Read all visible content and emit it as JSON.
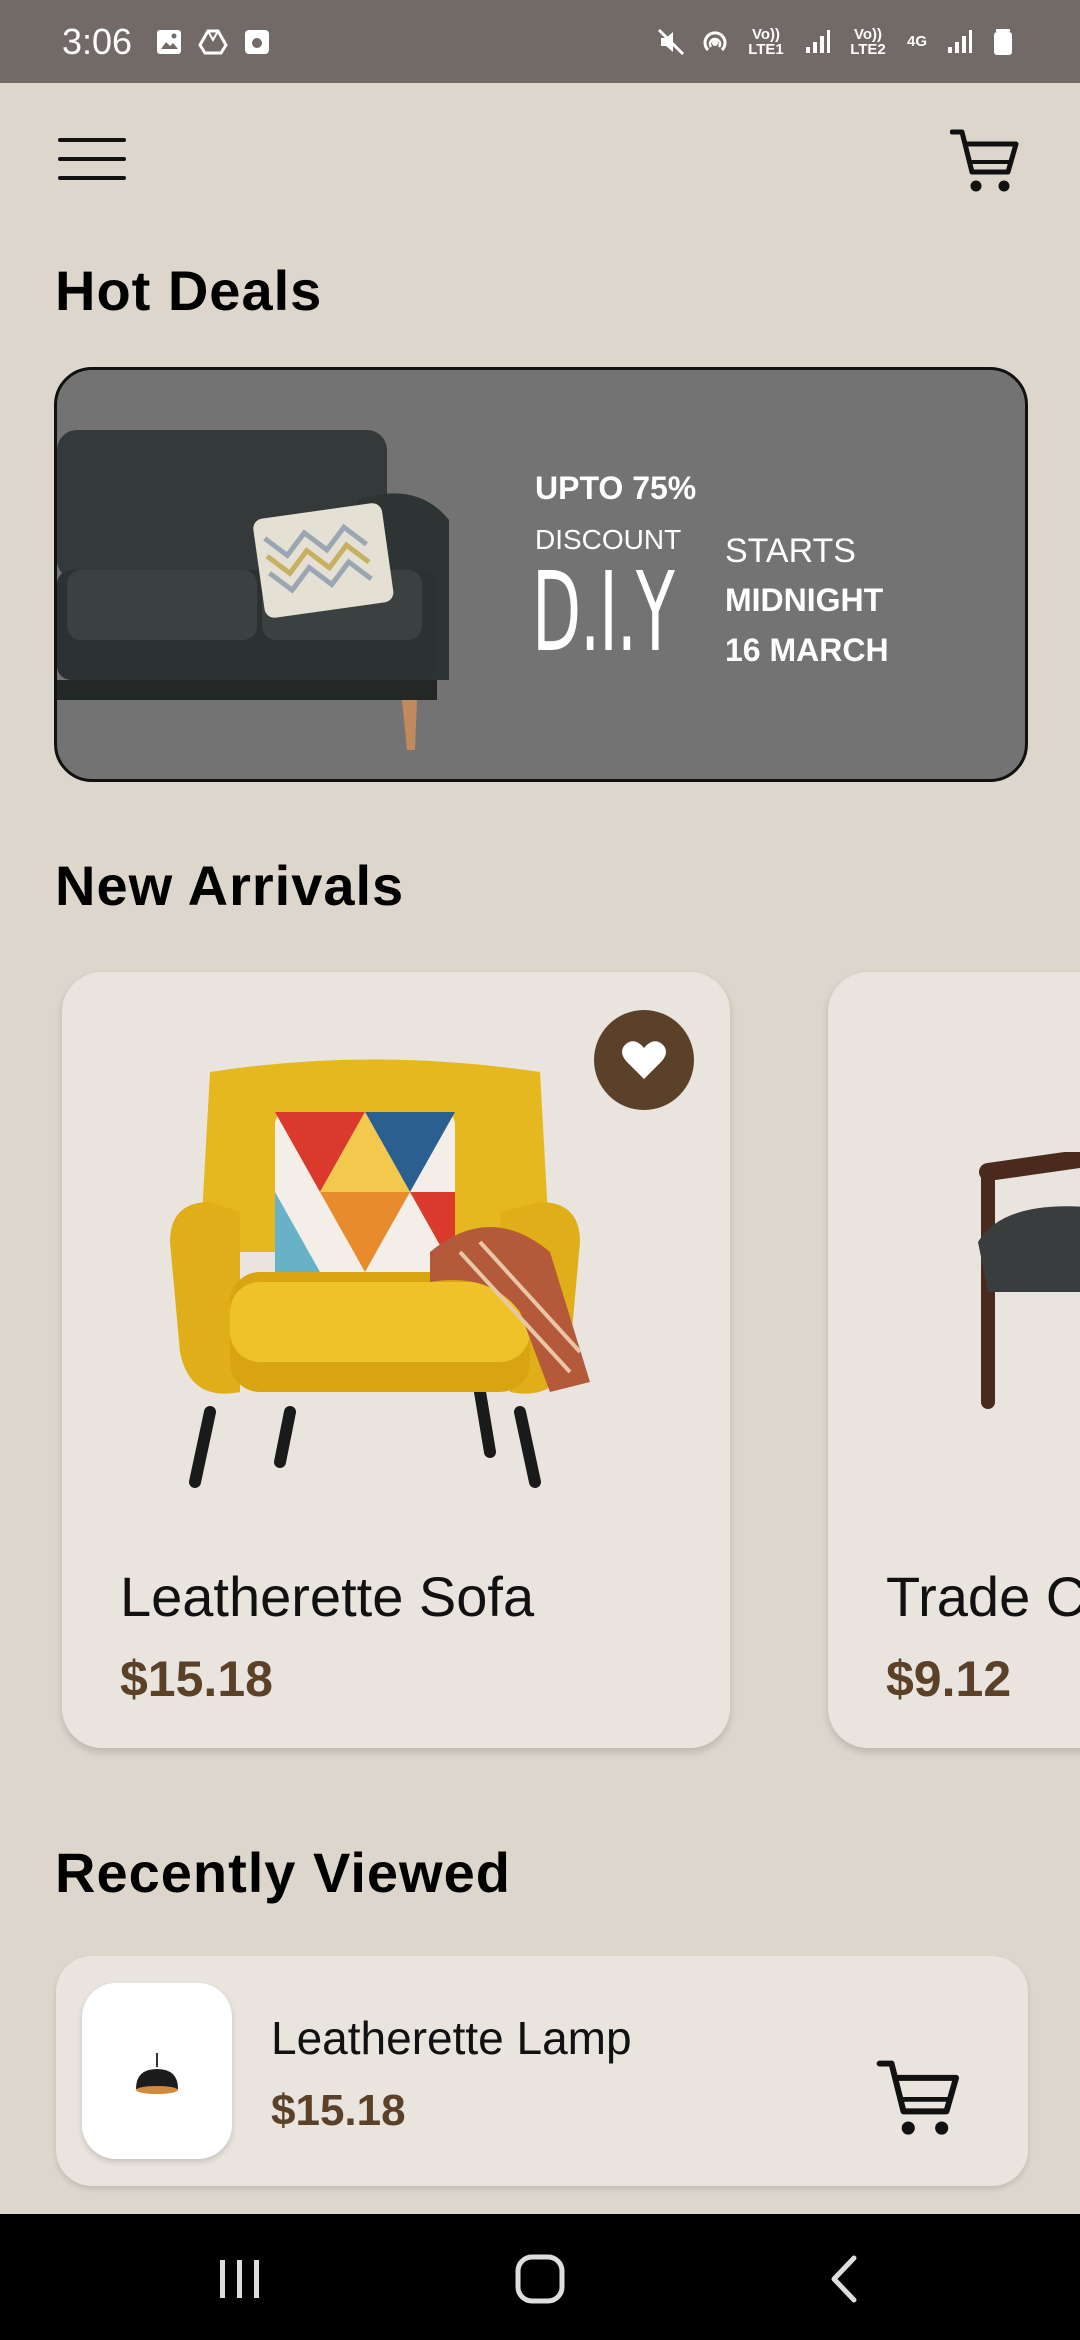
{
  "status_bar": {
    "time": "3:06",
    "left_icons": [
      "image-icon",
      "drive-icon",
      "square-app-icon"
    ],
    "right_icons": [
      "mute-icon",
      "hotspot-icon",
      "volte-lte1-icon",
      "signal-icon",
      "volte-lte2-icon",
      "4g-icon",
      "signal-icon",
      "battery-icon"
    ],
    "lte1": "Vo)) LTE1",
    "lte2": "Vo)) LTE2",
    "net": "4G"
  },
  "app_bar": {
    "menu_icon": "hamburger-menu-icon",
    "cart_icon": "shopping-cart-icon"
  },
  "hot_deals": {
    "title": "Hot Deals",
    "banner": {
      "line1": "UPTO 75%",
      "line2": "DISCOUNT",
      "brand": "D.I.Y",
      "starts": "STARTS",
      "midnight": "MIDNIGHT",
      "date": "16 MARCH"
    }
  },
  "new_arrivals": {
    "title": "New Arrivals",
    "items": [
      {
        "name": "Leatherette Sofa",
        "price": "$15.18",
        "favorite_icon": "heart-icon"
      },
      {
        "name": "Trade C",
        "price": "$9.12"
      }
    ]
  },
  "recently_viewed": {
    "title": "Recently Viewed",
    "items": [
      {
        "name": "Leatherette Lamp",
        "price": "$15.18",
        "cart_icon": "shopping-cart-icon"
      }
    ]
  },
  "nav_bar": {
    "buttons": [
      "recent-apps-icon",
      "home-icon",
      "back-icon"
    ]
  },
  "colors": {
    "background": "#dcd6cc",
    "status_bar": "#716a67",
    "card": "#e9e4de",
    "price": "#5c4129",
    "accent_brown": "#5b4129",
    "banner": "#737373"
  }
}
